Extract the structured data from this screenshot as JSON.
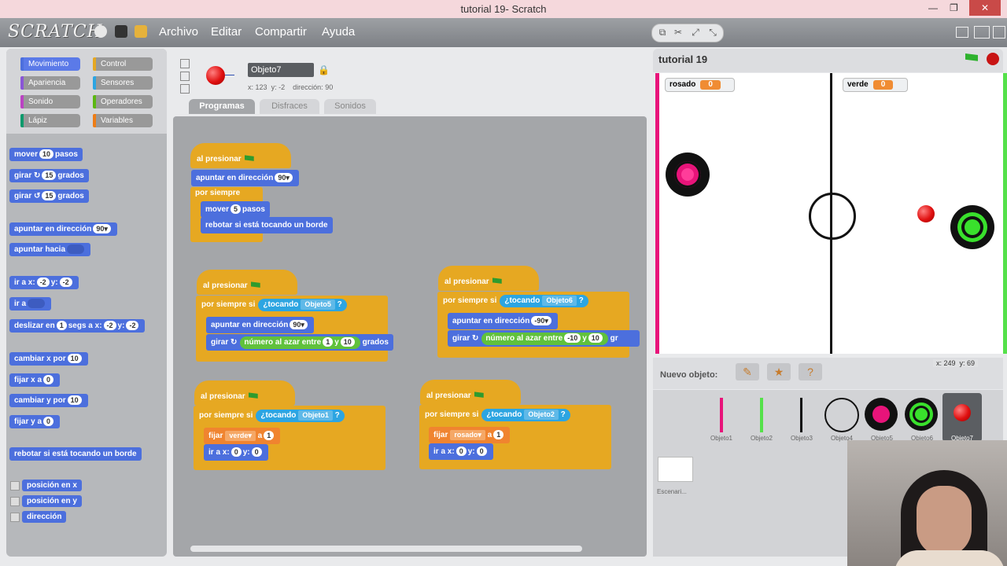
{
  "window": {
    "title": "tutorial 19- Scratch"
  },
  "menubar": {
    "logo": "SCRATCH",
    "items": [
      "Archivo",
      "Editar",
      "Compartir",
      "Ayuda"
    ]
  },
  "categories": [
    {
      "label": "Movimiento",
      "color": "#4c6fdd"
    },
    {
      "label": "Control",
      "color": "#e6a822"
    },
    {
      "label": "Apariencia",
      "color": "#8a55d7"
    },
    {
      "label": "Sensores",
      "color": "#2ca5e2"
    },
    {
      "label": "Sonido",
      "color": "#bb42c3"
    },
    {
      "label": "Operadores",
      "color": "#5cb712"
    },
    {
      "label": "Lápiz",
      "color": "#0e9a6c"
    },
    {
      "label": "Variables",
      "color": "#ee7d16"
    }
  ],
  "palette": {
    "mover": "mover",
    "mover_val": "10",
    "pasos": "pasos",
    "girar": "girar",
    "girar1_val": "15",
    "grados": "grados",
    "girar2_val": "15",
    "apuntar_dir": "apuntar en dirección",
    "apuntar_dir_val": "90▾",
    "apuntar_hacia": "apuntar hacia",
    "ir_a": "ir a x:",
    "ir_x": "-2",
    "y_label": "y:",
    "ir_y": "-2",
    "ir_a2": "ir a",
    "deslizar": "deslizar en",
    "desl_val": "1",
    "segs": "segs a x:",
    "desl_x": "-2",
    "desl_y": "-2",
    "cambiar_x": "cambiar x por",
    "cambiar_x_val": "10",
    "fijar_x": "fijar x a",
    "fijar_x_val": "0",
    "cambiar_y": "cambiar y por",
    "cambiar_y_val": "10",
    "fijar_y": "fijar y a",
    "fijar_y_val": "0",
    "rebotar": "rebotar si está tocando un borde",
    "rep1": "posición en x",
    "rep2": "posición en y",
    "rep3": "dirección"
  },
  "sprite": {
    "name": "Objeto7",
    "x_label": "x:",
    "x": "123",
    "y_label": "y:",
    "y": "-2",
    "dir_label": "dirección:",
    "dir": "90"
  },
  "tabs": [
    "Programas",
    "Disfraces",
    "Sonidos"
  ],
  "scripts": {
    "s1": {
      "hat": "al presionar",
      "b1": "apuntar en dirección",
      "b1v": "90▾",
      "b2": "por siempre",
      "b3": "mover",
      "b3v": "5",
      "b3b": "pasos",
      "b4": "rebotar si está tocando un borde"
    },
    "s2": {
      "hat": "al presionar",
      "loop": "por siempre si",
      "sense": "¿tocando",
      "target": "Objeto5",
      "q": "?",
      "b1": "apuntar en dirección",
      "b1v": "90▾",
      "girar": "girar",
      "rand": "número al azar entre",
      "r1": "1",
      "y": "y",
      "r2": "10",
      "grados": "grados"
    },
    "s3": {
      "hat": "al presionar",
      "loop": "por siempre si",
      "sense": "¿tocando",
      "target": "Objeto6",
      "q": "?",
      "b1": "apuntar en dirección",
      "b1v": "-90▾",
      "girar": "girar",
      "rand": "número al azar entre",
      "r1": "-10",
      "y": "y",
      "r2": "10",
      "grados": "gr"
    },
    "s4": {
      "hat": "al presionar",
      "loop": "por siempre si",
      "sense": "¿tocando",
      "target": "Objeto1",
      "q": "?",
      "fijar": "fijar",
      "var": "verde▾",
      "a": "a",
      "val": "1",
      "ir": "ir a x:",
      "x": "0",
      "yl": "y:",
      "yv": "0"
    },
    "s5": {
      "hat": "al presionar",
      "loop": "por siempre si",
      "sense": "¿tocando",
      "target": "Objeto2",
      "q": "?",
      "fijar": "fijar",
      "var": "rosado▾",
      "a": "a",
      "val": "1",
      "ir": "ir a x:",
      "x": "0",
      "yl": "y:",
      "yv": "0"
    }
  },
  "stage": {
    "title": "tutorial 19",
    "var1_name": "rosado",
    "var1_val": "0",
    "var2_name": "verde",
    "var2_val": "0",
    "coords_x": "x: 249",
    "coords_y": "y: 69"
  },
  "newsprite": {
    "label": "Nuevo objeto:"
  },
  "sprites": [
    "Objeto1",
    "Objeto2",
    "Objeto3",
    "Objeto4",
    "Objeto5",
    "Objeto6",
    "Objeto7"
  ],
  "stage_thumb": {
    "label": "Escenari..."
  }
}
